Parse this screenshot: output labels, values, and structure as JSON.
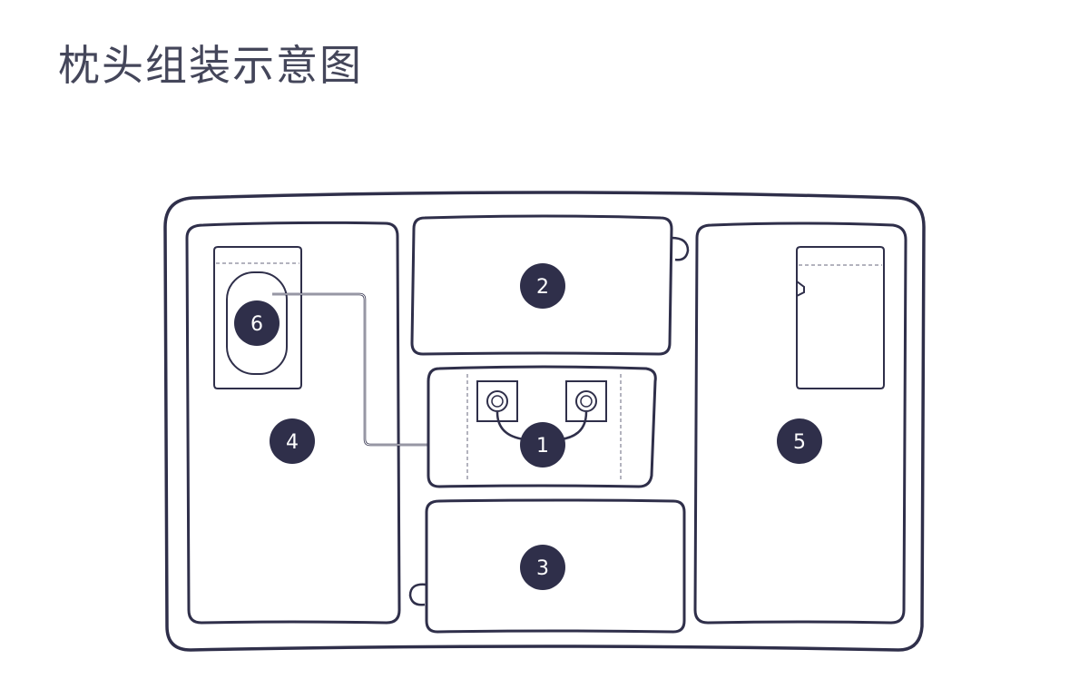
{
  "title": "枕头组装示意图",
  "colors": {
    "stroke": "#2f2f4a",
    "marker_fill": "#2f2f4a",
    "marker_text": "#ffffff",
    "title_text": "#44465a",
    "dashed": "#9a9aa8"
  },
  "markers": {
    "m1": "1",
    "m2": "2",
    "m3": "3",
    "m4": "4",
    "m5": "5",
    "m6": "6"
  }
}
